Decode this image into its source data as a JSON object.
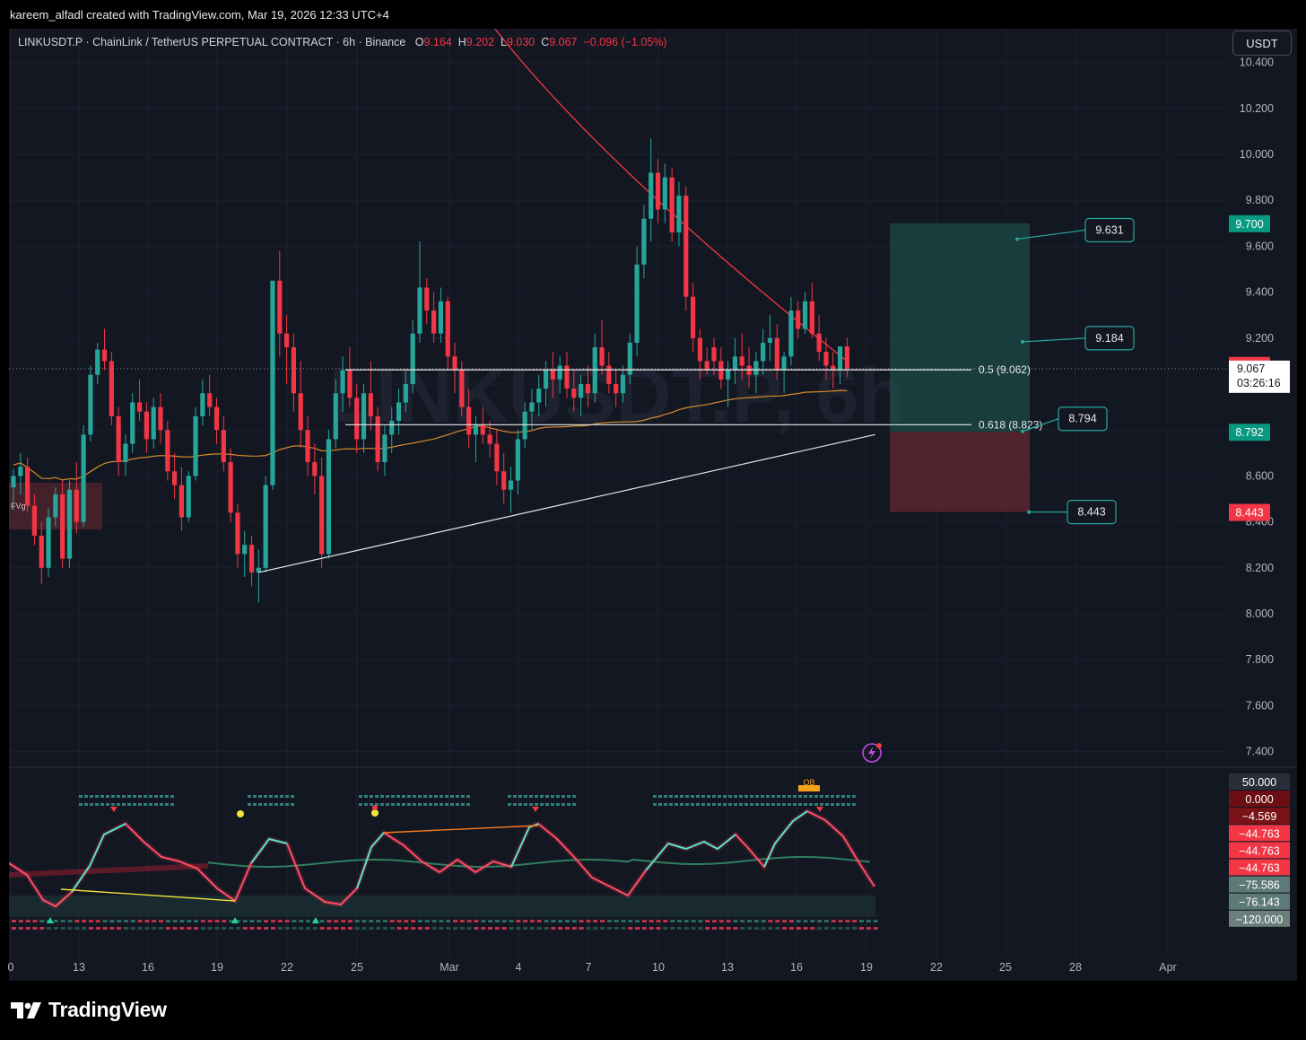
{
  "header": {
    "attribution": "kareem_alfadl created with TradingView.com, Mar 19, 2026 12:33 UTC+4"
  },
  "legend": {
    "symbol_line": "LINKUSDT.P · ChainLink / TetherUS PERPETUAL CONTRACT · 6h · Binance",
    "o_label": "O",
    "o_value": "9.164",
    "h_label": "H",
    "h_value": "9.202",
    "l_label": "L",
    "l_value": "9.030",
    "c_label": "C",
    "c_value": "9.067",
    "change": "−0.096 (−1.05%)"
  },
  "currency_button": "USDT",
  "watermark": "LINKUSDT.P, 6h",
  "branding": "TradingView",
  "colors": {
    "up": "#26a69a",
    "down": "#f23645",
    "background": "#131722",
    "ma_red": "#f23645",
    "ma_orange": "#d68a2a"
  },
  "chart_data": {
    "type": "candlestick",
    "symbol": "LINKUSDT.P",
    "timeframe": "6h",
    "exchange": "Binance",
    "price_axis": {
      "ticks": [
        "10.400",
        "10.200",
        "10.000",
        "9.800",
        "9.600",
        "9.400",
        "9.200",
        "8.600",
        "8.400",
        "8.200",
        "8.000",
        "7.800",
        "7.600",
        "7.400"
      ],
      "ylim": [
        7.32,
        10.48
      ]
    },
    "time_axis": {
      "ticks": [
        "0",
        "13",
        "16",
        "19",
        "22",
        "25",
        "Mar",
        "4",
        "7",
        "10",
        "13",
        "16",
        "19",
        "22",
        "25",
        "28",
        "Apr"
      ]
    },
    "price_tags": [
      {
        "value": "9.700",
        "color": "#089981"
      },
      {
        "value": "9.083",
        "color": "#f23645"
      },
      {
        "value": "9.067",
        "countdown": "03:26:16",
        "color": "#ffffff"
      },
      {
        "value": "8.792",
        "color": "#089981"
      },
      {
        "value": "8.443",
        "color": "#f23645"
      }
    ],
    "fib_levels": [
      {
        "label": "0.5 (9.062)",
        "price": 9.062
      },
      {
        "label": "0.618 (8.823)",
        "price": 8.823
      }
    ],
    "position": {
      "target": 9.7,
      "entry": 8.792,
      "stop": 8.443
    },
    "callouts": [
      {
        "text": "9.631",
        "price": 9.631
      },
      {
        "text": "9.184",
        "price": 9.184
      },
      {
        "text": "8.794",
        "price": 8.794
      },
      {
        "text": "8.443",
        "price": 8.443
      }
    ],
    "fvg_label": "FVg",
    "trendline": {
      "from": {
        "index": 35,
        "price": 8.18
      },
      "to": {
        "index": 123,
        "price": 8.78
      }
    },
    "indicator": {
      "axis_labels": [
        {
          "value": "50.000",
          "color": "#2a2e39"
        },
        {
          "value": "0.000",
          "color": "#6b0f14"
        },
        {
          "value": "−4.569",
          "color": "#7a1218"
        },
        {
          "value": "−44.763",
          "color": "#f23645"
        },
        {
          "value": "−44.763",
          "color": "#f23645"
        },
        {
          "value": "−44.763",
          "color": "#f23645"
        },
        {
          "value": "−75.586",
          "color": "#5e7a76"
        },
        {
          "value": "−76.143",
          "color": "#5e7a76"
        },
        {
          "value": "−120.000",
          "color": "#6b7f7c"
        }
      ],
      "ob_label": "OB"
    },
    "candles": [
      [
        8.55,
        8.63,
        8.45,
        8.6
      ],
      [
        8.6,
        8.7,
        8.52,
        8.64
      ],
      [
        8.64,
        8.68,
        8.44,
        8.47
      ],
      [
        8.47,
        8.52,
        8.3,
        8.34
      ],
      [
        8.34,
        8.4,
        8.13,
        8.2
      ],
      [
        8.2,
        8.46,
        8.16,
        8.42
      ],
      [
        8.42,
        8.55,
        8.38,
        8.52
      ],
      [
        8.52,
        8.58,
        8.2,
        8.24
      ],
      [
        8.24,
        8.58,
        8.2,
        8.54
      ],
      [
        8.54,
        8.66,
        8.35,
        8.4
      ],
      [
        8.4,
        8.82,
        8.38,
        8.78
      ],
      [
        8.78,
        9.08,
        8.75,
        9.04
      ],
      [
        9.04,
        9.18,
        9.0,
        9.15
      ],
      [
        9.15,
        9.24,
        9.06,
        9.1
      ],
      [
        9.1,
        9.14,
        8.82,
        8.86
      ],
      [
        8.86,
        8.9,
        8.6,
        8.66
      ],
      [
        8.66,
        8.78,
        8.6,
        8.74
      ],
      [
        8.74,
        8.96,
        8.7,
        8.92
      ],
      [
        8.92,
        9.02,
        8.84,
        8.88
      ],
      [
        8.88,
        8.92,
        8.7,
        8.76
      ],
      [
        8.76,
        8.94,
        8.72,
        8.9
      ],
      [
        8.9,
        8.96,
        8.74,
        8.8
      ],
      [
        8.8,
        8.84,
        8.58,
        8.62
      ],
      [
        8.62,
        8.7,
        8.5,
        8.56
      ],
      [
        8.56,
        8.64,
        8.36,
        8.42
      ],
      [
        8.42,
        8.62,
        8.4,
        8.6
      ],
      [
        8.6,
        8.9,
        8.58,
        8.86
      ],
      [
        8.86,
        9.02,
        8.82,
        8.96
      ],
      [
        8.96,
        9.04,
        8.86,
        8.9
      ],
      [
        8.9,
        8.94,
        8.74,
        8.8
      ],
      [
        8.8,
        8.86,
        8.62,
        8.66
      ],
      [
        8.66,
        8.72,
        8.4,
        8.44
      ],
      [
        8.44,
        8.48,
        8.2,
        8.26
      ],
      [
        8.26,
        8.36,
        8.16,
        8.3
      ],
      [
        8.3,
        8.34,
        8.12,
        8.18
      ],
      [
        8.18,
        8.28,
        8.05,
        8.2
      ],
      [
        8.2,
        8.6,
        8.18,
        8.56
      ],
      [
        8.56,
        9.0,
        8.54,
        9.45
      ],
      [
        9.45,
        9.58,
        9.12,
        9.22
      ],
      [
        9.22,
        9.3,
        9.0,
        9.16
      ],
      [
        9.16,
        9.22,
        8.88,
        8.96
      ],
      [
        8.96,
        9.1,
        8.72,
        8.8
      ],
      [
        8.8,
        8.86,
        8.6,
        8.66
      ],
      [
        8.66,
        8.74,
        8.52,
        8.6
      ],
      [
        8.6,
        8.68,
        8.2,
        8.26
      ],
      [
        8.26,
        8.8,
        8.24,
        8.76
      ],
      [
        8.76,
        9.02,
        8.72,
        8.96
      ],
      [
        8.96,
        9.12,
        8.88,
        9.06
      ],
      [
        9.06,
        9.16,
        8.9,
        8.94
      ],
      [
        8.94,
        9.0,
        8.7,
        8.76
      ],
      [
        8.76,
        9.0,
        8.7,
        8.96
      ],
      [
        8.96,
        9.1,
        8.8,
        8.86
      ],
      [
        8.86,
        8.9,
        8.62,
        8.66
      ],
      [
        8.66,
        8.82,
        8.6,
        8.78
      ],
      [
        8.78,
        8.9,
        8.7,
        8.84
      ],
      [
        8.84,
        8.98,
        8.78,
        8.92
      ],
      [
        8.92,
        9.06,
        8.88,
        9.0
      ],
      [
        9.0,
        9.28,
        8.96,
        9.22
      ],
      [
        9.22,
        9.62,
        9.18,
        9.42
      ],
      [
        9.42,
        9.46,
        9.26,
        9.32
      ],
      [
        9.32,
        9.4,
        9.18,
        9.22
      ],
      [
        9.22,
        9.42,
        9.18,
        9.36
      ],
      [
        9.36,
        9.38,
        9.06,
        9.12
      ],
      [
        9.12,
        9.18,
        8.96,
        9.06
      ],
      [
        9.06,
        9.1,
        8.86,
        8.9
      ],
      [
        8.9,
        8.98,
        8.72,
        8.78
      ],
      [
        8.78,
        8.86,
        8.66,
        8.82
      ],
      [
        8.82,
        8.9,
        8.74,
        8.78
      ],
      [
        8.78,
        8.84,
        8.68,
        8.74
      ],
      [
        8.74,
        8.8,
        8.56,
        8.62
      ],
      [
        8.62,
        8.7,
        8.48,
        8.54
      ],
      [
        8.54,
        8.64,
        8.44,
        8.58
      ],
      [
        8.58,
        8.8,
        8.52,
        8.76
      ],
      [
        8.76,
        8.92,
        8.72,
        8.88
      ],
      [
        8.88,
        8.98,
        8.8,
        8.92
      ],
      [
        8.92,
        9.04,
        8.86,
        8.98
      ],
      [
        8.98,
        9.1,
        8.9,
        9.06
      ],
      [
        9.06,
        9.14,
        8.94,
        9.02
      ],
      [
        9.02,
        9.12,
        8.96,
        9.08
      ],
      [
        9.08,
        9.14,
        8.94,
        8.98
      ],
      [
        8.98,
        9.06,
        8.88,
        8.94
      ],
      [
        8.94,
        9.04,
        8.86,
        9.0
      ],
      [
        9.0,
        9.08,
        8.9,
        8.96
      ],
      [
        8.96,
        9.22,
        8.92,
        9.16
      ],
      [
        9.16,
        9.28,
        9.04,
        9.08
      ],
      [
        9.08,
        9.14,
        8.96,
        9.0
      ],
      [
        9.0,
        9.06,
        8.9,
        8.96
      ],
      [
        8.96,
        9.08,
        8.92,
        9.04
      ],
      [
        9.04,
        9.22,
        9.0,
        9.18
      ],
      [
        9.18,
        9.6,
        9.12,
        9.52
      ],
      [
        9.52,
        9.78,
        9.46,
        9.72
      ],
      [
        9.72,
        10.07,
        9.62,
        9.92
      ],
      [
        9.92,
        9.98,
        9.7,
        9.76
      ],
      [
        9.76,
        9.96,
        9.7,
        9.9
      ],
      [
        9.9,
        9.94,
        9.62,
        9.66
      ],
      [
        9.66,
        9.88,
        9.6,
        9.82
      ],
      [
        9.82,
        9.86,
        9.32,
        9.38
      ],
      [
        9.38,
        9.44,
        9.14,
        9.2
      ],
      [
        9.2,
        9.24,
        9.02,
        9.1
      ],
      [
        9.1,
        9.16,
        9.04,
        9.06
      ],
      [
        9.16,
        9.2,
        9.04,
        9.1
      ],
      [
        9.1,
        9.16,
        8.98,
        9.02
      ],
      [
        9.02,
        9.1,
        8.9,
        9.06
      ],
      [
        9.06,
        9.2,
        9.0,
        9.12
      ],
      [
        9.12,
        9.22,
        9.02,
        9.08
      ],
      [
        9.08,
        9.16,
        8.98,
        9.04
      ],
      [
        9.04,
        9.14,
        8.96,
        9.1
      ],
      [
        9.1,
        9.24,
        9.04,
        9.18
      ],
      [
        9.18,
        9.3,
        9.1,
        9.2
      ],
      [
        9.2,
        9.26,
        9.02,
        9.06
      ],
      [
        9.06,
        9.14,
        8.96,
        9.12
      ],
      [
        9.12,
        9.38,
        9.08,
        9.32
      ],
      [
        9.32,
        9.36,
        9.2,
        9.24
      ],
      [
        9.24,
        9.4,
        9.22,
        9.36
      ],
      [
        9.36,
        9.44,
        9.2,
        9.22
      ],
      [
        9.22,
        9.3,
        9.1,
        9.14
      ],
      [
        9.14,
        9.2,
        9.02,
        9.08
      ],
      [
        9.08,
        9.14,
        8.98,
        9.06
      ],
      [
        9.06,
        9.16,
        9.0,
        9.164
      ],
      [
        9.164,
        9.202,
        9.03,
        9.067
      ]
    ]
  }
}
